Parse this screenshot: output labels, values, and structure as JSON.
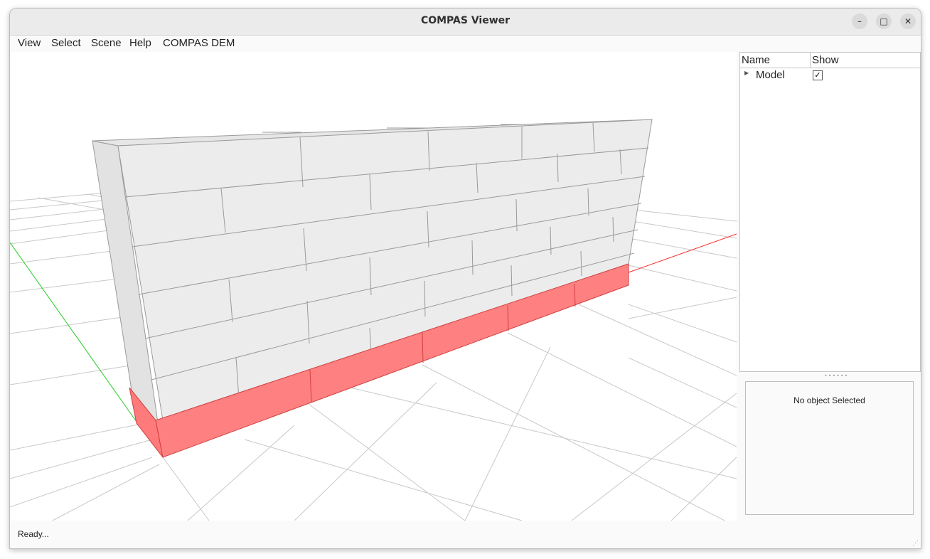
{
  "window": {
    "title": "COMPAS Viewer",
    "controls": {
      "minimize": "–",
      "maximize": "□",
      "close": "✕"
    }
  },
  "menu": [
    "View",
    "Select",
    "Scene",
    "Help",
    "COMPAS DEM"
  ],
  "scene_tree": {
    "headers": {
      "name": "Name",
      "show": "Show"
    },
    "rows": [
      {
        "label": "Model",
        "visible": true,
        "check_glyph": "✓"
      }
    ]
  },
  "selection_panel": {
    "message": "No object Selected"
  },
  "status": {
    "text": "Ready..."
  },
  "viewport": {
    "background": "#ffffff",
    "grid_color": "#c8c8c8",
    "x_axis_color": "#ff2020",
    "y_axis_color": "#22cc22",
    "block_fill": "#ececec",
    "block_edge": "#9a9a9a",
    "support_fill": "#ff8080",
    "support_edge": "#d04040",
    "icons": [
      "wall-model",
      "grid-plane",
      "x-axis",
      "y-axis"
    ]
  }
}
